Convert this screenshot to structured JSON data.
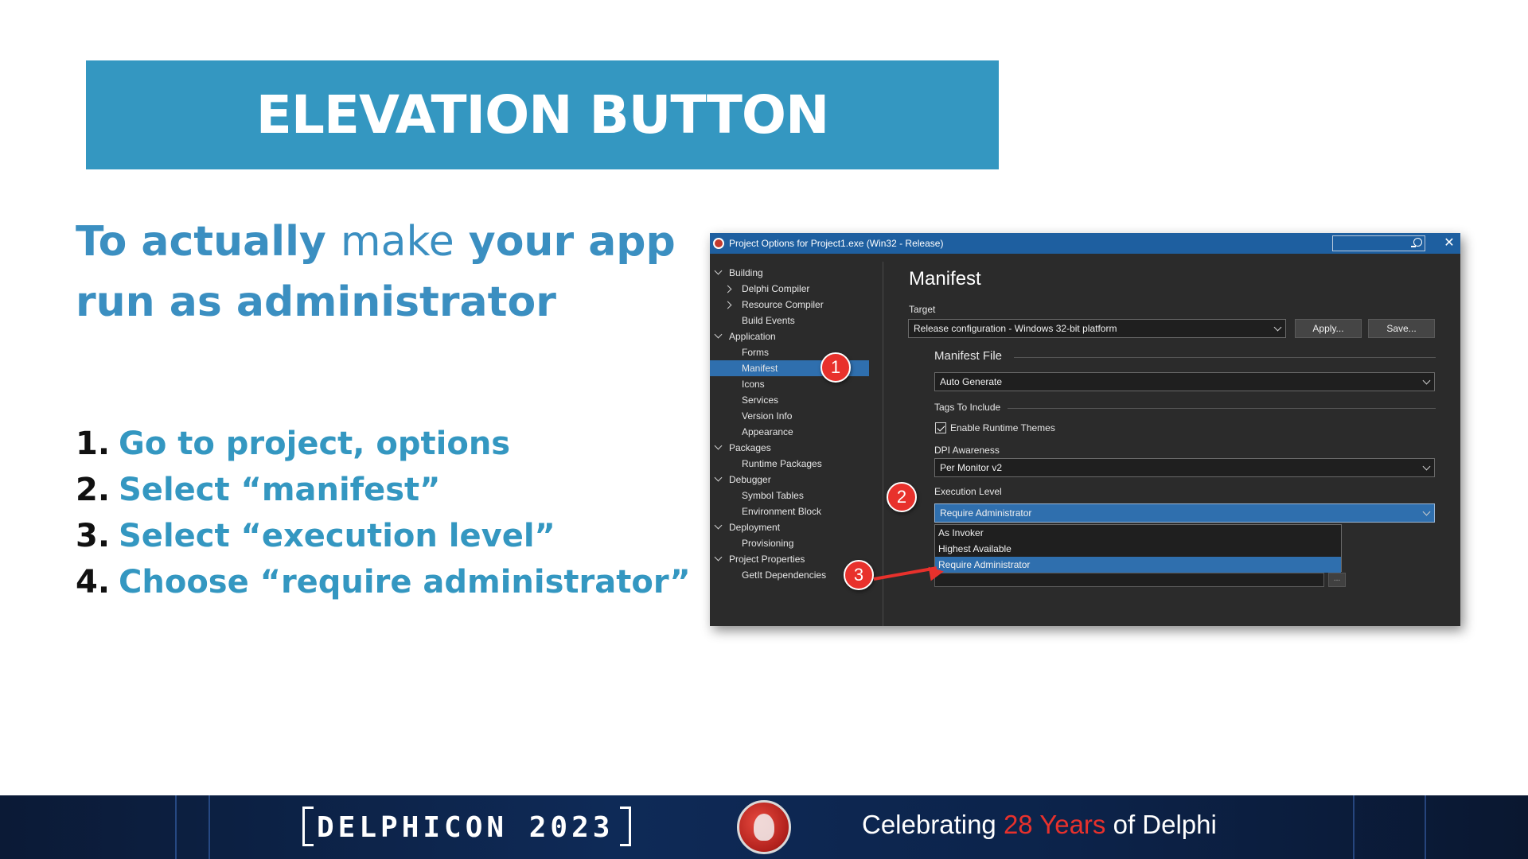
{
  "slide": {
    "title": "ELEVATION BUTTON",
    "headline": {
      "part1": "To actually ",
      "part2": "make",
      "part3": " your app",
      "part4": "run as administrator"
    },
    "steps": [
      {
        "num": "1.",
        "text": "Go to project, options"
      },
      {
        "num": "2.",
        "text": "Select “manifest”"
      },
      {
        "num": "3.",
        "text": "Select “execution level”"
      },
      {
        "num": "4.",
        "text": "Choose “require administrator”"
      }
    ]
  },
  "dialog": {
    "title": "Project Options for Project1.exe  (Win32 - Release)",
    "close_glyph": "✕",
    "tree": [
      {
        "label": "Building",
        "level": 0,
        "expander": "down"
      },
      {
        "label": "Delphi Compiler",
        "level": 1,
        "expander": "right"
      },
      {
        "label": "Resource Compiler",
        "level": 1,
        "expander": "right"
      },
      {
        "label": "Build Events",
        "level": 1
      },
      {
        "label": "Application",
        "level": 0,
        "expander": "down"
      },
      {
        "label": "Forms",
        "level": 1
      },
      {
        "label": "Manifest",
        "level": 1,
        "selected": true
      },
      {
        "label": "Icons",
        "level": 1
      },
      {
        "label": "Services",
        "level": 1
      },
      {
        "label": "Version Info",
        "level": 1
      },
      {
        "label": "Appearance",
        "level": 1
      },
      {
        "label": "Packages",
        "level": 0,
        "expander": "down"
      },
      {
        "label": "Runtime Packages",
        "level": 1
      },
      {
        "label": "Debugger",
        "level": 0,
        "expander": "down"
      },
      {
        "label": "Symbol Tables",
        "level": 1
      },
      {
        "label": "Environment Block",
        "level": 1
      },
      {
        "label": "Deployment",
        "level": 0,
        "expander": "down"
      },
      {
        "label": "Provisioning",
        "level": 1
      },
      {
        "label": "Project Properties",
        "level": 0,
        "expander": "down"
      },
      {
        "label": "GetIt Dependencies",
        "level": 1
      }
    ],
    "pane": {
      "title": "Manifest",
      "target_label": "Target",
      "target_value": "Release configuration - Windows 32-bit platform",
      "apply_label": "Apply...",
      "save_label": "Save...",
      "manifest_file_label": "Manifest File",
      "manifest_file_value": "Auto Generate",
      "tags_label": "Tags To Include",
      "runtime_themes_label": "Enable Runtime Themes",
      "runtime_themes_checked": true,
      "dpi_label": "DPI Awareness",
      "dpi_value": "Per Monitor v2",
      "exec_level_label": "Execution Level",
      "exec_level_value": "Require Administrator",
      "exec_level_options": [
        "As Invoker",
        "Highest Available",
        "Require Administrator"
      ],
      "exec_level_selected": "Require Administrator",
      "ellipsis": "..."
    },
    "badges": [
      "1",
      "2",
      "3"
    ]
  },
  "footer": {
    "brand": "DELPHICON 2023",
    "tag_prefix": "Celebrating ",
    "tag_highlight": "28 Years",
    "tag_suffix": " of Delphi",
    "colors": {
      "accent": "#e8312c",
      "banner": "#3497c1",
      "dialog_titlebar": "#1e5fa0",
      "selection": "#2f6fae"
    }
  }
}
